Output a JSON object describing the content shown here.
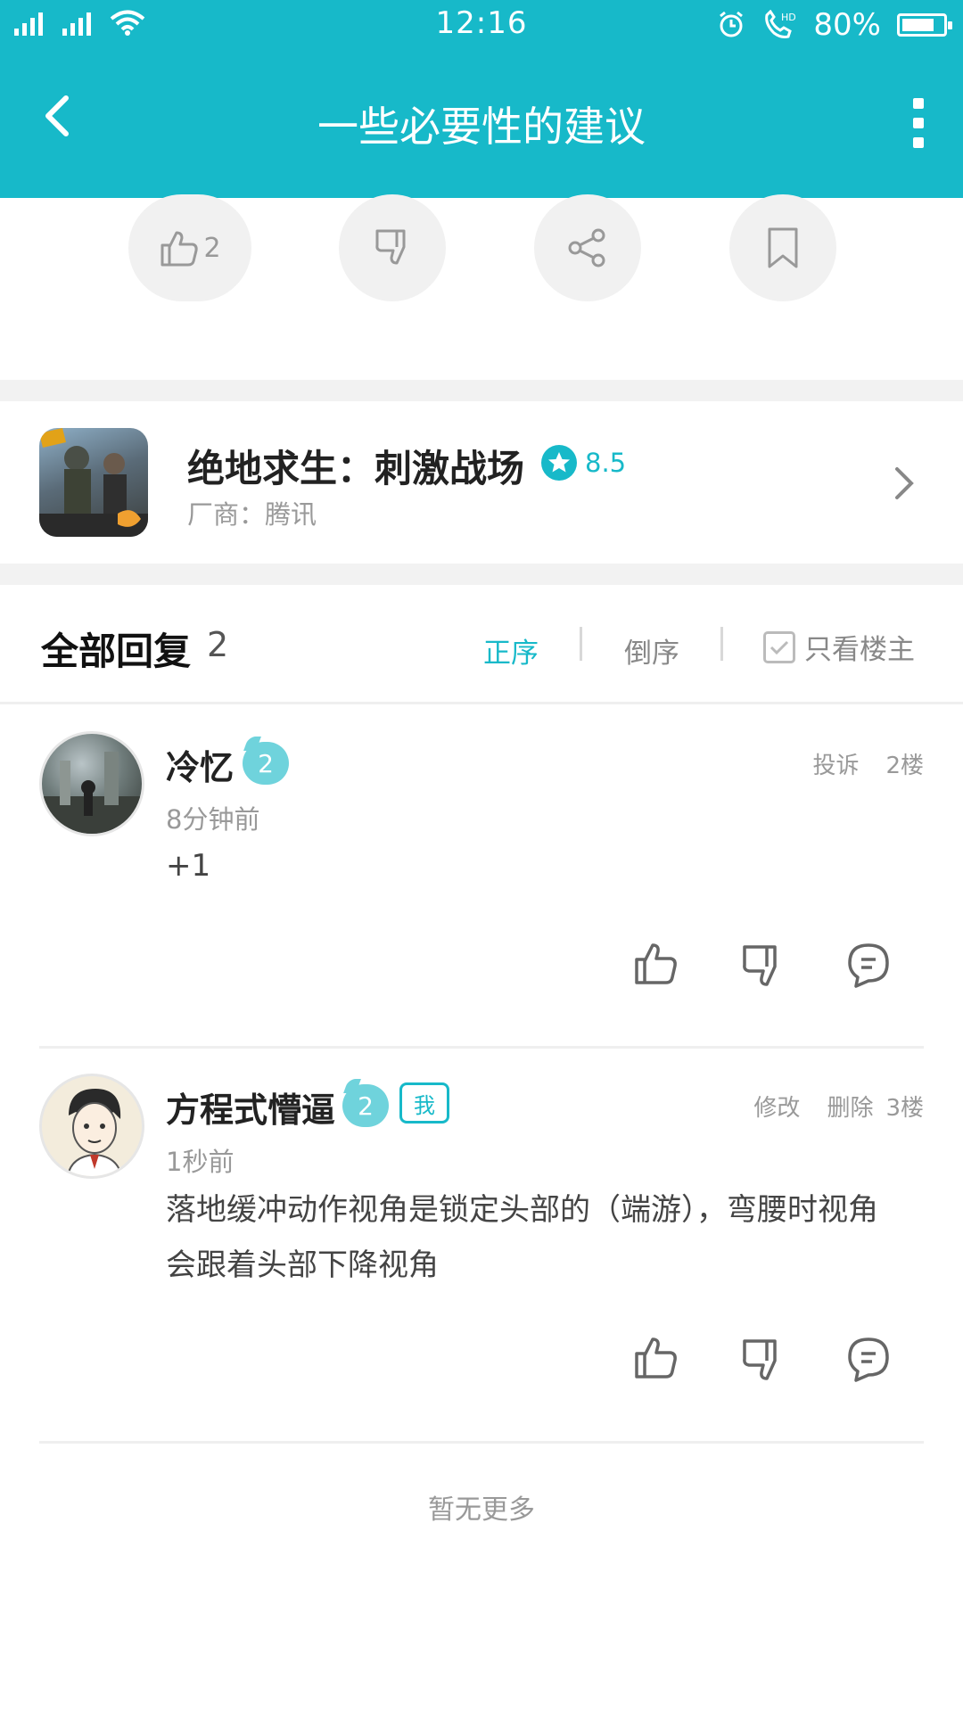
{
  "status_bar": {
    "net1": "4G",
    "net2": "2G",
    "time": "12:16",
    "hd": "HD",
    "battery_text": "80%",
    "battery_level": 0.8
  },
  "header": {
    "title": "一些必要性的建议",
    "accent_color": "#17b9c9"
  },
  "actions": {
    "like_count": "2",
    "icons": [
      "thumbs-up-icon",
      "thumbs-down-icon",
      "share-icon",
      "bookmark-icon"
    ]
  },
  "game": {
    "name": "绝地求生：刺激战场",
    "score": "8.5",
    "vendor": "厂商：腾讯"
  },
  "replies_header": {
    "title": "全部回复",
    "count": "2",
    "sort_asc": "正序",
    "sort_desc": "倒序",
    "only_op": "只看楼主"
  },
  "comments": [
    {
      "username": "冷忆",
      "level": "2",
      "report": "投诉",
      "floor": "2楼",
      "time_ago": "8分钟前",
      "content": "+1"
    },
    {
      "username": "方程式懵逼",
      "level": "2",
      "me_badge": "我",
      "edit": "修改",
      "delete": "删除",
      "floor": "3楼",
      "time_ago": "1秒前",
      "content": "落地缓冲动作视角是锁定头部的（端游），弯腰时视角会跟着头部下降视角"
    }
  ],
  "footer": {
    "no_more": "暂无更多"
  }
}
